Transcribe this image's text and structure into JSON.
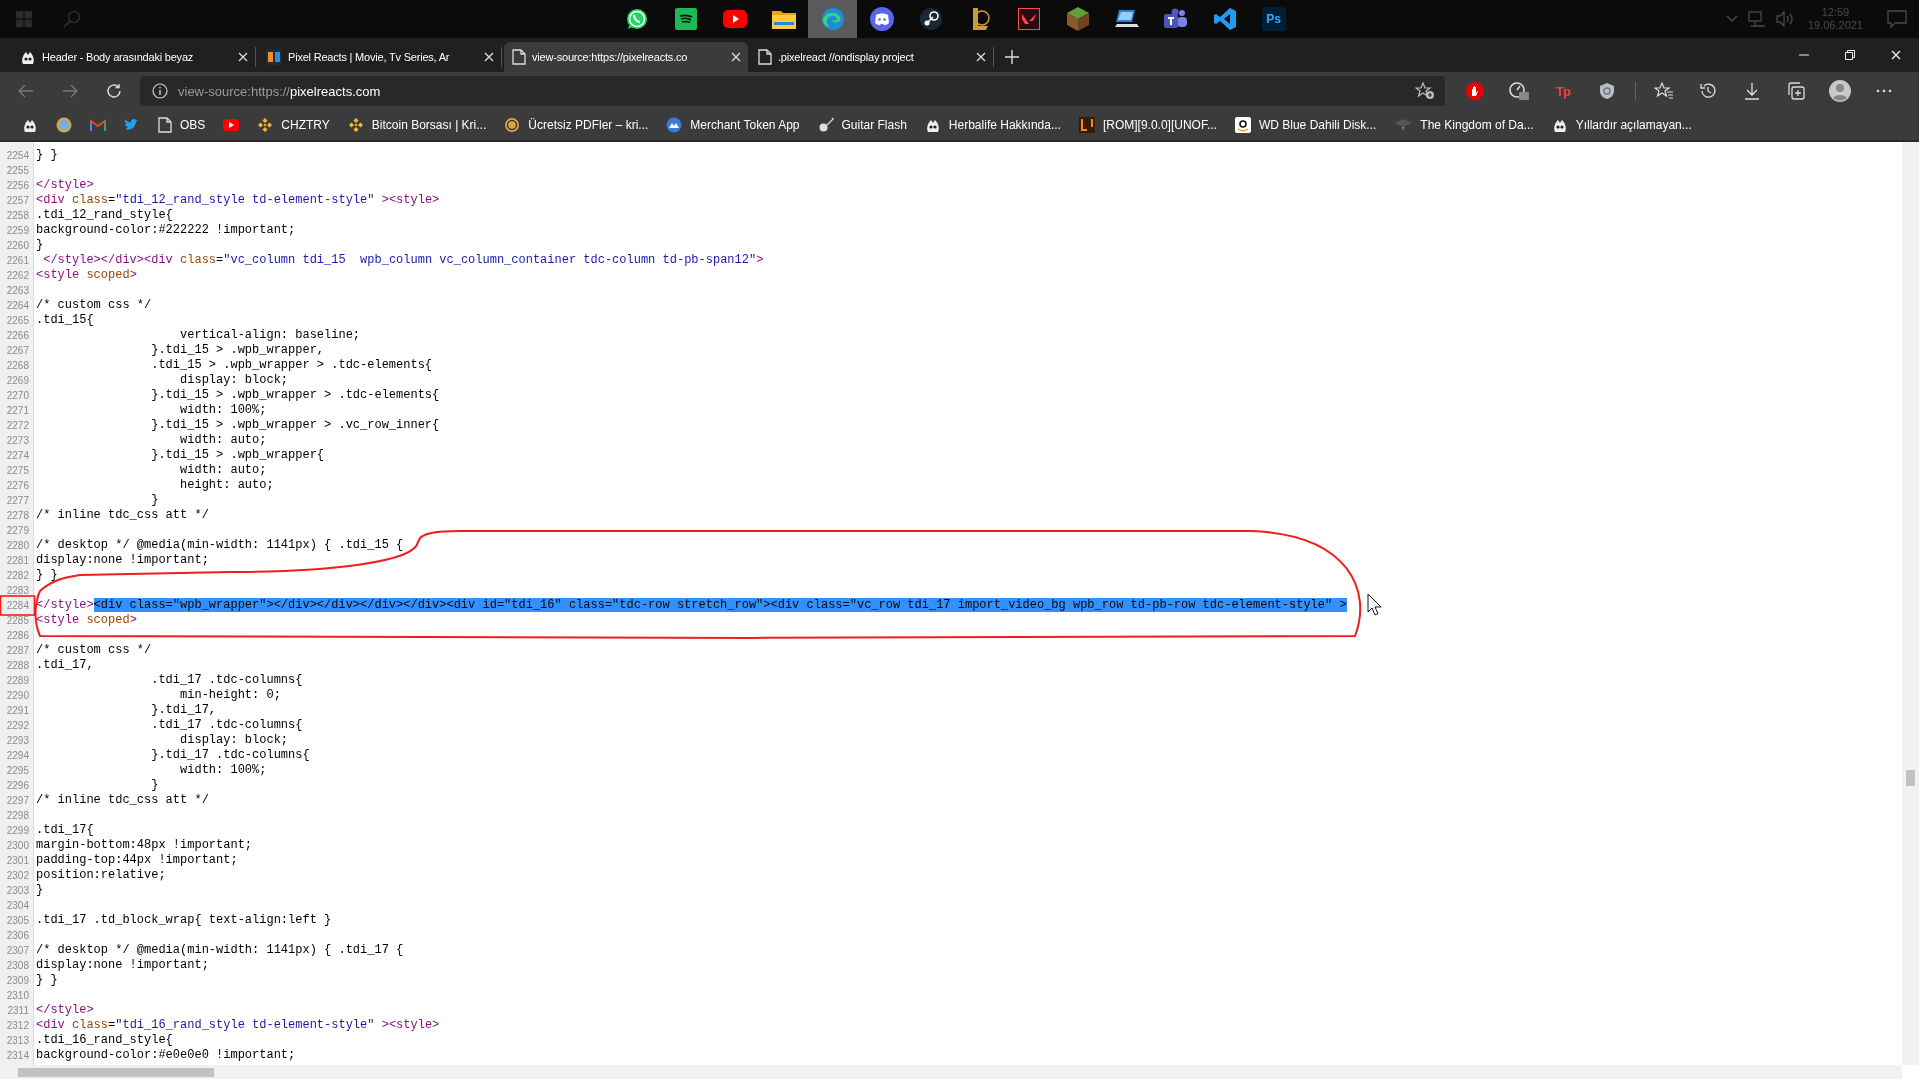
{
  "taskbar": {
    "apps": [
      {
        "kind": "whatsapp",
        "selected": false
      },
      {
        "kind": "spotify",
        "selected": false
      },
      {
        "kind": "youtube",
        "selected": false
      },
      {
        "kind": "folder",
        "selected": false
      },
      {
        "kind": "edge",
        "selected": true
      },
      {
        "kind": "discord",
        "selected": false
      },
      {
        "kind": "steam",
        "selected": false
      },
      {
        "kind": "league",
        "selected": false
      },
      {
        "kind": "valorant",
        "selected": false
      },
      {
        "kind": "minecraft",
        "selected": false
      },
      {
        "kind": "computer",
        "selected": false
      },
      {
        "kind": "teams",
        "selected": false
      },
      {
        "kind": "vscode",
        "selected": false
      },
      {
        "kind": "photoshop",
        "selected": false,
        "label": "Ps"
      }
    ],
    "clock": {
      "time": "12:59",
      "date": "19.06.2021"
    }
  },
  "tabs": [
    {
      "title": "Header - Body arasındaki beyaz",
      "kind": "mascot",
      "selected": false
    },
    {
      "title": "Pixel Reacts | Movie, Tv Series, Ar",
      "kind": "logo",
      "selected": false
    },
    {
      "title": "view-source:https://pixelreacts.co",
      "kind": "page",
      "selected": true
    },
    {
      "title": ".pixelreact //ondisplay project",
      "kind": "page",
      "selected": false
    }
  ],
  "address_bar": {
    "scheme": "view-source:https://",
    "host": "pixelreacts.com"
  },
  "extensions": [
    {
      "kind": "adblock"
    },
    {
      "kind": "gauge"
    },
    {
      "kind": "tp",
      "label": "Tp"
    },
    {
      "kind": "shield"
    }
  ],
  "bookmarks": [
    {
      "kind": "mascot"
    },
    {
      "kind": "globe"
    },
    {
      "kind": "gmail"
    },
    {
      "kind": "twitter"
    },
    {
      "kind": "page",
      "label": "OBS"
    },
    {
      "kind": "youtube"
    },
    {
      "kind": "binance",
      "label": "CHZTRY"
    },
    {
      "kind": "binance",
      "label": "Bitcoin Borsası | Kri..."
    },
    {
      "kind": "coin",
      "label": "Ücretsiz PDFler – kri..."
    },
    {
      "kind": "merchant",
      "label": "Merchant Token App"
    },
    {
      "kind": "guitar",
      "label": "Guitar Flash"
    },
    {
      "kind": "mascot",
      "label": "Herbalife Hakkında..."
    },
    {
      "kind": "rom",
      "label": "[ROM][9.0.0][UNOF..."
    },
    {
      "kind": "amazon",
      "label": "WD Blue Dahili Disk..."
    },
    {
      "kind": "hat",
      "label": "The Kingdom of Da..."
    },
    {
      "kind": "mascot",
      "label": "Yıllardır açılamayan..."
    }
  ],
  "source": {
    "lines": [
      {
        "number": "2254",
        "text": "} }"
      },
      {
        "number": "2255"
      },
      {
        "number": "2256",
        "tokens": [
          {
            "kind": "tag",
            "text": "</style>"
          }
        ]
      },
      {
        "number": "2257",
        "tokens": [
          {
            "kind": "tag",
            "text": "<div "
          },
          {
            "kind": "attr",
            "text": "class"
          },
          {
            "kind": "plain",
            "text": "="
          },
          {
            "kind": "value",
            "text": "\"tdi_12_rand_style td-element-style\""
          },
          {
            "kind": "tag",
            "text": " ><style>"
          }
        ]
      },
      {
        "number": "2258",
        "text": ".tdi_12_rand_style{"
      },
      {
        "number": "2259",
        "text": "background-color:#222222 !important;"
      },
      {
        "number": "2260",
        "text": "}"
      },
      {
        "number": "2261",
        "tokens": [
          {
            "kind": "tag",
            "text": " </style></div><div "
          },
          {
            "kind": "attr",
            "text": "class"
          },
          {
            "kind": "plain",
            "text": "="
          },
          {
            "kind": "value",
            "text": "\"vc_column tdi_15  wpb_column vc_column_container tdc-column td-pb-span12\""
          },
          {
            "kind": "tag",
            "text": ">"
          }
        ]
      },
      {
        "number": "2262",
        "tokens": [
          {
            "kind": "tag",
            "text": "<style "
          },
          {
            "kind": "attr",
            "text": "scoped"
          },
          {
            "kind": "tag",
            "text": ">"
          }
        ]
      },
      {
        "number": "2263"
      },
      {
        "number": "2264",
        "text": "/* custom css */"
      },
      {
        "number": "2265",
        "text": ".tdi_15{"
      },
      {
        "number": "2266",
        "text": "                    vertical-align: baseline;"
      },
      {
        "number": "2267",
        "text": "                }.tdi_15 > .wpb_wrapper,"
      },
      {
        "number": "2268",
        "text": "                .tdi_15 > .wpb_wrapper > .tdc-elements{"
      },
      {
        "number": "2269",
        "text": "                    display: block;"
      },
      {
        "number": "2270",
        "text": "                }.tdi_15 > .wpb_wrapper > .tdc-elements{"
      },
      {
        "number": "2271",
        "text": "                    width: 100%;"
      },
      {
        "number": "2272",
        "text": "                }.tdi_15 > .wpb_wrapper > .vc_row_inner{"
      },
      {
        "number": "2273",
        "text": "                    width: auto;"
      },
      {
        "number": "2274",
        "text": "                }.tdi_15 > .wpb_wrapper{"
      },
      {
        "number": "2275",
        "text": "                    width: auto;"
      },
      {
        "number": "2276",
        "text": "                    height: auto;"
      },
      {
        "number": "2277",
        "text": "                }"
      },
      {
        "number": "2278",
        "text": "/* inline tdc_css att */"
      },
      {
        "number": "2279"
      },
      {
        "number": "2280",
        "text": "/* desktop */ @media(min-width: 1141px) { .tdi_15 {"
      },
      {
        "number": "2281",
        "text": "display:none !important;"
      },
      {
        "number": "2282",
        "text": "} }"
      },
      {
        "number": "2283"
      },
      {
        "number": "2284",
        "tokens": [
          {
            "kind": "tag",
            "text": "</style>"
          },
          {
            "kind": "selected",
            "text": "<div class=\"wpb_wrapper\"></div></div></div></div><div id=\"tdi_16\" class=\"tdc-row stretch_row\"><div class=\"vc_row tdi_17 import_video_bg wpb_row td-pb-row tdc-element-style\" >"
          }
        ]
      },
      {
        "number": "2285",
        "tokens": [
          {
            "kind": "tag",
            "text": "<style "
          },
          {
            "kind": "attr",
            "text": "scoped"
          },
          {
            "kind": "tag",
            "text": ">"
          }
        ]
      },
      {
        "number": "2286"
      },
      {
        "number": "2287",
        "text": "/* custom css */"
      },
      {
        "number": "2288",
        "text": ".tdi_17,"
      },
      {
        "number": "2289",
        "text": "                .tdi_17 .tdc-columns{"
      },
      {
        "number": "2290",
        "text": "                    min-height: 0;"
      },
      {
        "number": "2291",
        "text": "                }.tdi_17,"
      },
      {
        "number": "2292",
        "text": "                .tdi_17 .tdc-columns{"
      },
      {
        "number": "2293",
        "text": "                    display: block;"
      },
      {
        "number": "2294",
        "text": "                }.tdi_17 .tdc-columns{"
      },
      {
        "number": "2295",
        "text": "                    width: 100%;"
      },
      {
        "number": "2296",
        "text": "                }"
      },
      {
        "number": "2297",
        "text": "/* inline tdc_css att */"
      },
      {
        "number": "2298"
      },
      {
        "number": "2299",
        "text": ".tdi_17{"
      },
      {
        "number": "2300",
        "text": "margin-bottom:48px !important;"
      },
      {
        "number": "2301",
        "text": "padding-top:44px !important;"
      },
      {
        "number": "2302",
        "text": "position:relative;"
      },
      {
        "number": "2303",
        "text": "}"
      },
      {
        "number": "2304"
      },
      {
        "number": "2305",
        "text": ".tdi_17 .td_block_wrap{ text-align:left }"
      },
      {
        "number": "2306"
      },
      {
        "number": "2307",
        "text": "/* desktop */ @media(min-width: 1141px) { .tdi_17 {"
      },
      {
        "number": "2308",
        "text": "display:none !important;"
      },
      {
        "number": "2309",
        "text": "} }"
      },
      {
        "number": "2310"
      },
      {
        "number": "2311",
        "tokens": [
          {
            "kind": "tag",
            "text": "</style>"
          }
        ]
      },
      {
        "number": "2312",
        "tokens": [
          {
            "kind": "tag",
            "text": "<div "
          },
          {
            "kind": "attr",
            "text": "class"
          },
          {
            "kind": "plain",
            "text": "="
          },
          {
            "kind": "value",
            "text": "\"tdi_16_rand_style td-element-style\""
          },
          {
            "kind": "tag",
            "text": " ><style>"
          }
        ]
      },
      {
        "number": "2313",
        "text": ".tdi_16_rand_style{"
      },
      {
        "number": "2314",
        "text": "background-color:#e0e0e0 !important;"
      }
    ]
  }
}
